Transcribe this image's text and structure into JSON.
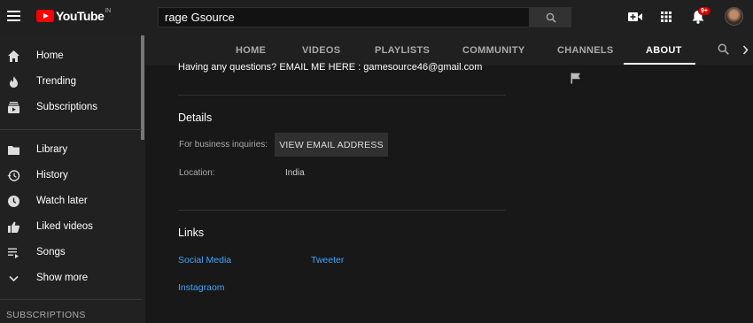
{
  "header": {
    "logo_text": "YouTube",
    "logo_region": "IN",
    "search_value": "rage Gsource",
    "notification_count": "9+"
  },
  "sidebar": {
    "items": [
      {
        "label": "Home",
        "icon": "home-icon"
      },
      {
        "label": "Trending",
        "icon": "flame-icon"
      },
      {
        "label": "Subscriptions",
        "icon": "subscriptions-icon"
      },
      {
        "label": "Library",
        "icon": "folder-icon"
      },
      {
        "label": "History",
        "icon": "history-icon"
      },
      {
        "label": "Watch later",
        "icon": "clock-icon"
      },
      {
        "label": "Liked videos",
        "icon": "thumbs-up-icon"
      },
      {
        "label": "Songs",
        "icon": "playlist-icon"
      },
      {
        "label": "Show more",
        "icon": "chevron-down-icon"
      }
    ],
    "subscriptions_heading": "SUBSCRIPTIONS"
  },
  "tabs": [
    "HOME",
    "VIDEOS",
    "PLAYLISTS",
    "COMMUNITY",
    "CHANNELS",
    "ABOUT"
  ],
  "active_tab": "ABOUT",
  "about": {
    "description": "Having any questions? EMAIL ME HERE : gamesource46@gmail.com",
    "details_title": "Details",
    "business_label": "For business inquiries:",
    "email_button": "VIEW EMAIL ADDRESS",
    "location_label": "Location:",
    "location_value": "India",
    "links_title": "Links",
    "links": [
      "Social Media",
      "Tweeter",
      "Instagraom"
    ]
  },
  "colors": {
    "background": "#181818",
    "bar": "#202020",
    "accent_red": "#ff0000",
    "link": "#3ea6ff"
  }
}
